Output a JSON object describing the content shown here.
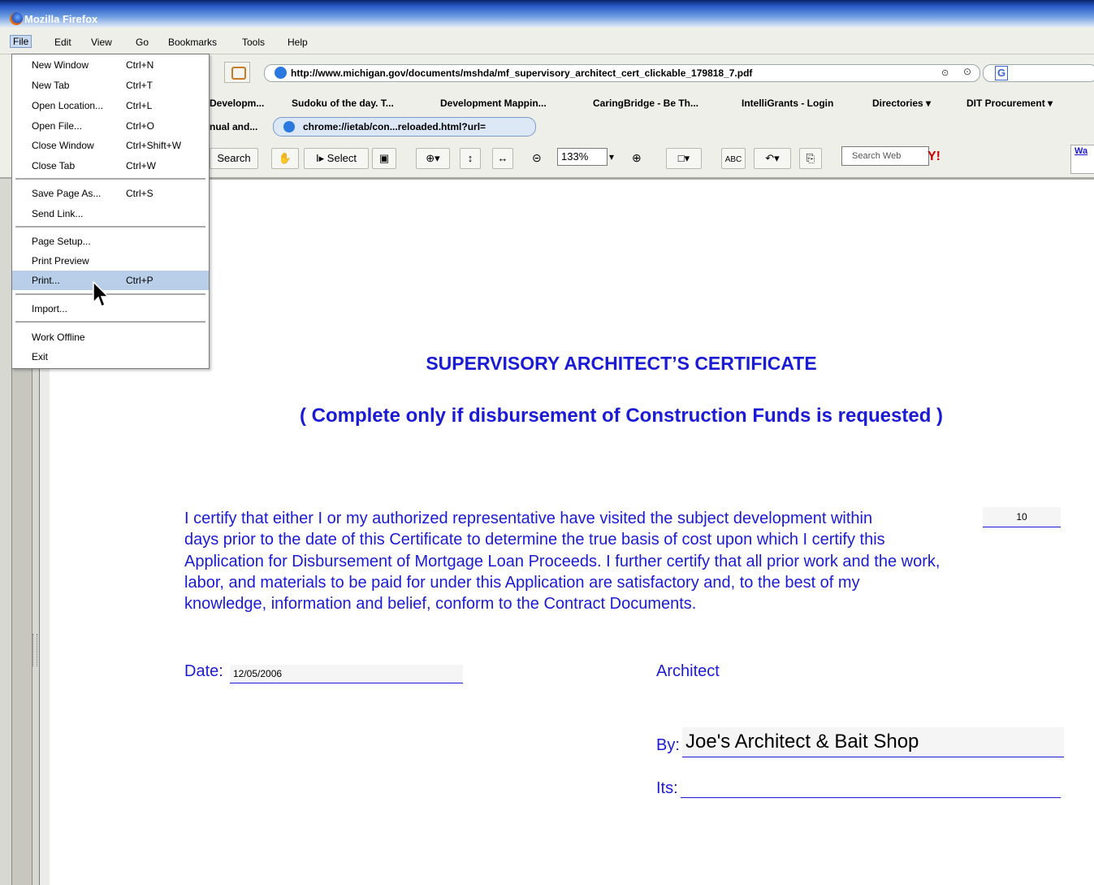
{
  "window": {
    "title": "Mozilla Firefox"
  },
  "menubar": {
    "items": [
      "File",
      "Edit",
      "View",
      "Go",
      "Bookmarks",
      "Tools",
      "Help"
    ]
  },
  "navbar": {
    "url": "http://www.michigan.gov/documents/mshda/mf_supervisory_architect_cert_clickable_179818_7.pdf",
    "search_engine_icon": "G"
  },
  "bookmarks": {
    "items": [
      "Developm...",
      "Sudoku of the day. T...",
      "Development Mappin...",
      "CaringBridge - Be Th...",
      "IntelliGrants - Login",
      "Directories ▾",
      "DIT Procurement ▾"
    ]
  },
  "tabs": {
    "previous": "nual and...",
    "active": "chrome://ietab/con...reloaded.html?url="
  },
  "pdf_toolbar": {
    "search_label": "Search",
    "select_label": "Select",
    "zoom": "133%",
    "web_search_placeholder": "Search Web",
    "yahoo": "Y!",
    "right_edge": "Wa"
  },
  "file_menu": {
    "items": [
      {
        "label": "New Window",
        "shortcut": "Ctrl+N"
      },
      {
        "label": "New Tab",
        "shortcut": "Ctrl+T"
      },
      {
        "label": "Open Location...",
        "shortcut": "Ctrl+L"
      },
      {
        "label": "Open File...",
        "shortcut": "Ctrl+O"
      },
      {
        "label": "Close Window",
        "shortcut": "Ctrl+Shift+W"
      },
      {
        "label": "Close Tab",
        "shortcut": "Ctrl+W"
      },
      {
        "label": "Save Page As...",
        "shortcut": "Ctrl+S"
      },
      {
        "label": "Send Link...",
        "shortcut": ""
      },
      {
        "label": "Page Setup...",
        "shortcut": ""
      },
      {
        "label": "Print Preview",
        "shortcut": ""
      },
      {
        "label": "Print...",
        "shortcut": "Ctrl+P"
      },
      {
        "label": "Import...",
        "shortcut": ""
      },
      {
        "label": "Work Offline",
        "shortcut": ""
      },
      {
        "label": "Exit",
        "shortcut": ""
      }
    ],
    "highlighted": "Print..."
  },
  "document": {
    "title": "SUPERVISORY ARCHITECT’S CERTIFICATE",
    "subtitle": "( Complete only if disbursement of Construction Funds is requested )",
    "paragraph": "I certify that either I or my authorized representative have visited the subject development within days prior to the date of this Certificate to determine the true basis of cost upon which I certify this Application for Disbursement of Mortgage Loan Proceeds.  I further certify that all prior work and the work, labor, and materials to be paid for under this Application are satisfactory and, to the best of my knowledge, information and belief, conform to the Contract Documents.",
    "para_lines": [
      "I certify that either I or my authorized representative have visited the subject development within",
      "days prior to the date of this Certificate to determine the true basis of cost upon which I certify this",
      "Application for Disbursement of Mortgage Loan Proceeds.  I further certify that all prior work and the work,",
      "labor, and materials to be paid for under this Application are satisfactory and, to the best of my",
      "knowledge, information and belief, conform to the Contract Documents."
    ],
    "days_value": "10",
    "date_label": "Date:",
    "date_value": "12/05/2006",
    "architect_label": "Architect",
    "by_label": "By:",
    "by_value": "Joe's Architect & Bait Shop",
    "its_label": "Its:"
  }
}
